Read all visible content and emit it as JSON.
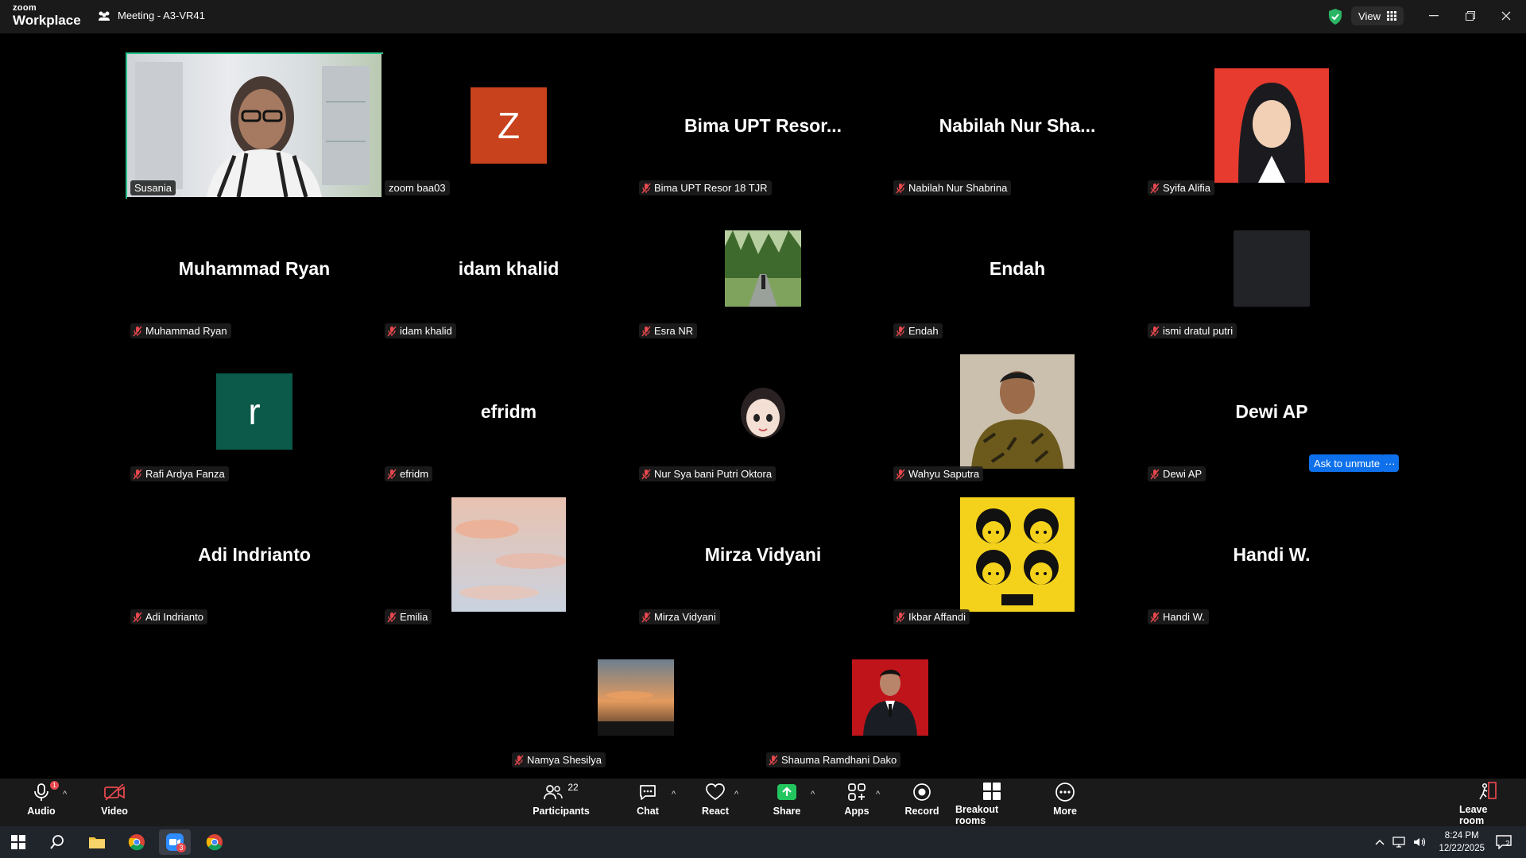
{
  "app": {
    "logo_line1": "zoom",
    "logo_line2": "Workplace",
    "meeting_title": "Meeting - A3-VR41",
    "view_label": "View"
  },
  "tiles": [
    {
      "label": "Susania",
      "muted": false,
      "type": "video"
    },
    {
      "label": "zoom baa03",
      "muted": false,
      "type": "letter",
      "letter": "Z",
      "color": "#c8421d"
    },
    {
      "label": "Bima UPT Resor 18 TJR",
      "muted": true,
      "type": "name",
      "display": "Bima UPT Resor..."
    },
    {
      "label": "Nabilah Nur Shabrina",
      "muted": true,
      "type": "name",
      "display": "Nabilah Nur Sha..."
    },
    {
      "label": "Syifa Alifia",
      "muted": true,
      "type": "photo",
      "photo": "hijab-portrait-red"
    },
    {
      "label": "Muhammad Ryan",
      "muted": true,
      "type": "name",
      "display": "Muhammad Ryan"
    },
    {
      "label": "idam khalid",
      "muted": true,
      "type": "name",
      "display": "idam khalid"
    },
    {
      "label": "Esra NR",
      "muted": true,
      "type": "photo",
      "photo": "forest-road"
    },
    {
      "label": "Endah",
      "muted": true,
      "type": "name",
      "display": "Endah"
    },
    {
      "label": "ismi dratul putri",
      "muted": true,
      "type": "photo",
      "photo": "dark-blank"
    },
    {
      "label": "Rafi Ardya Fanza",
      "muted": true,
      "type": "letter",
      "letter": "r",
      "color": "#0b5a4a"
    },
    {
      "label": "efridm",
      "muted": true,
      "type": "name",
      "display": "efridm"
    },
    {
      "label": "Nur Sya bani Putri Oktora",
      "muted": true,
      "type": "photo",
      "photo": "memoji"
    },
    {
      "label": "Wahyu Saputra",
      "muted": true,
      "type": "photo",
      "photo": "batik-portrait"
    },
    {
      "label": "Dewi AP",
      "muted": true,
      "type": "name",
      "display": "Dewi AP"
    },
    {
      "label": "Adi Indrianto",
      "muted": true,
      "type": "name",
      "display": "Adi Indrianto"
    },
    {
      "label": "Emilia",
      "muted": true,
      "type": "photo",
      "photo": "pink-sky"
    },
    {
      "label": "Mirza Vidyani",
      "muted": true,
      "type": "name",
      "display": "Mirza Vidyani"
    },
    {
      "label": "Ikbar Affandi",
      "muted": true,
      "type": "photo",
      "photo": "beatles"
    },
    {
      "label": "Handi W.",
      "muted": true,
      "type": "name",
      "display": "Handi W."
    },
    {
      "label": "Namya Shesilya",
      "muted": true,
      "type": "photo",
      "photo": "sunset"
    },
    {
      "label": "Shauma Ramdhani Dako",
      "muted": true,
      "type": "photo",
      "photo": "suit-portrait-red"
    }
  ],
  "hover_actions": {
    "ask_unmute": "Ask to unmute",
    "more": "···"
  },
  "toolbar": {
    "audio": "Audio",
    "video": "Video",
    "participants": "Participants",
    "participants_count": "22",
    "chat": "Chat",
    "react": "React",
    "share": "Share",
    "apps": "Apps",
    "record": "Record",
    "breakout": "Breakout rooms",
    "more": "More",
    "leave": "Leave room",
    "audio_badge": "1"
  },
  "taskbar": {
    "time": "8:24 PM",
    "date": "12/22/2025",
    "zoom_badge": "3",
    "notif_count": "2"
  },
  "colors": {
    "active_speaker": "#25c48a",
    "share_green": "#22c55e",
    "ask_blue": "#0e71eb",
    "mute_red": "#e5484d"
  }
}
